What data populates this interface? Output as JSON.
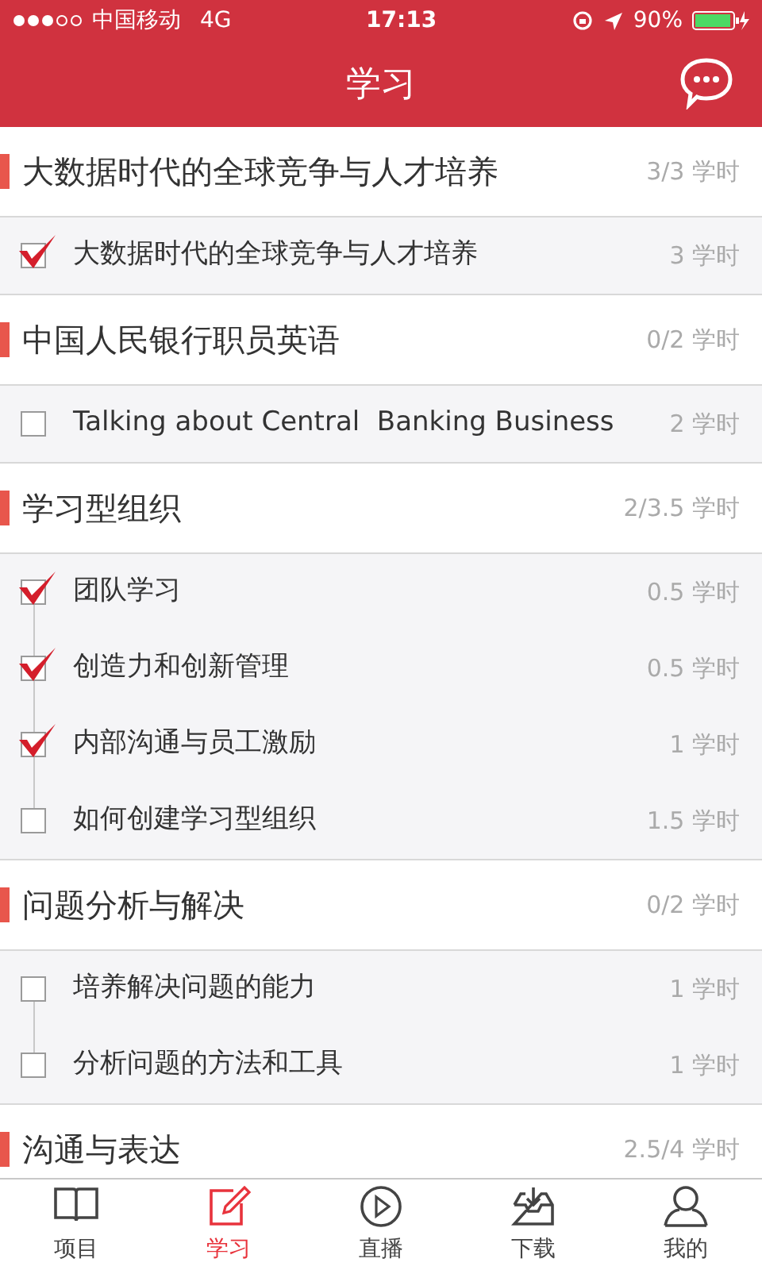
{
  "status_bar": {
    "carrier": "中国移动",
    "network": "4G",
    "time": "17:13",
    "battery": "90%"
  },
  "header": {
    "title": "学习"
  },
  "sections": [
    {
      "title": "大数据时代的全球竞争与人才培养",
      "hours": "3/3 学时",
      "items": [
        {
          "title": "大数据时代的全球竞争与人才培养",
          "hours": "3 学时",
          "checked": true
        }
      ]
    },
    {
      "title": "中国人民银行职员英语",
      "hours": "0/2 学时",
      "items": [
        {
          "title": "Talking about Central  Banking Business",
          "hours": "2 学时",
          "checked": false
        }
      ]
    },
    {
      "title": "学习型组织",
      "hours": "2/3.5 学时",
      "items": [
        {
          "title": "团队学习",
          "hours": "0.5 学时",
          "checked": true
        },
        {
          "title": "创造力和创新管理",
          "hours": "0.5 学时",
          "checked": true
        },
        {
          "title": "内部沟通与员工激励",
          "hours": "1 学时",
          "checked": true
        },
        {
          "title": "如何创建学习型组织",
          "hours": "1.5 学时",
          "checked": false
        }
      ]
    },
    {
      "title": "问题分析与解决",
      "hours": "0/2 学时",
      "items": [
        {
          "title": "培养解决问题的能力",
          "hours": "1 学时",
          "checked": false
        },
        {
          "title": "分析问题的方法和工具",
          "hours": "1 学时",
          "checked": false
        }
      ]
    },
    {
      "title": "沟通与表达",
      "hours": "2.5/4 学时"
    }
  ],
  "tab_bar": [
    {
      "label": "项目",
      "kind": "book",
      "selected": false
    },
    {
      "label": "学习",
      "kind": "note",
      "selected": true
    },
    {
      "label": "直播",
      "kind": "play",
      "selected": false
    },
    {
      "label": "下载",
      "kind": "download",
      "selected": false
    },
    {
      "label": "我的",
      "kind": "person",
      "selected": false
    }
  ]
}
